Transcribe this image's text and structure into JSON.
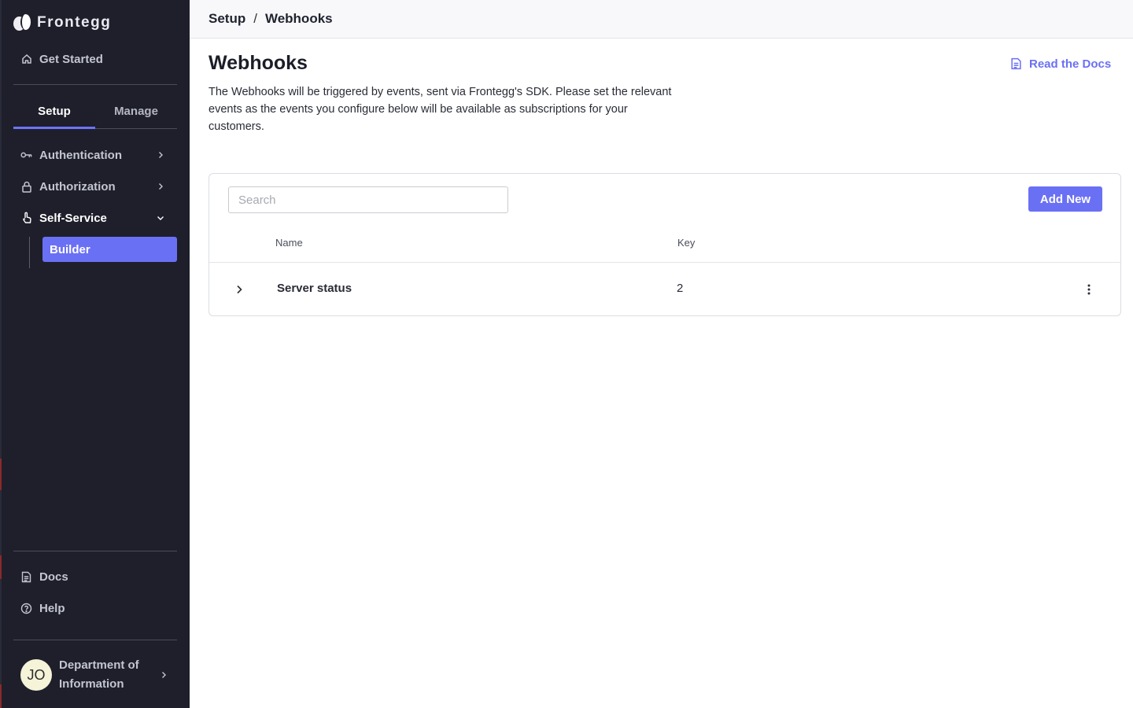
{
  "app": {
    "brand": "Frontegg"
  },
  "sidebar": {
    "get_started": "Get Started",
    "tabs": [
      {
        "label": "Setup",
        "active": true
      },
      {
        "label": "Manage",
        "active": false
      }
    ],
    "items": [
      {
        "label": "Authentication",
        "icon": "key-icon",
        "chevron": "right"
      },
      {
        "label": "Authorization",
        "icon": "lock-icon",
        "chevron": "right"
      },
      {
        "label": "Self-Service",
        "icon": "hand-pointer-icon",
        "chevron": "down",
        "expanded": true
      }
    ],
    "sub_items": [
      {
        "label": "Builder",
        "active": true
      }
    ],
    "bottom": [
      {
        "label": "Docs",
        "icon": "document-icon"
      },
      {
        "label": "Help",
        "icon": "help-circle-icon"
      }
    ],
    "user": {
      "initials": "JO",
      "name": "Department of Information"
    }
  },
  "breadcrumb": {
    "parent": "Setup",
    "separator": "/",
    "current": "Webhooks"
  },
  "page": {
    "title": "Webhooks",
    "description": "The Webhooks will be triggered by events, sent via Frontegg's SDK. Please set the relevant events as the events you configure below will be available as subscriptions for your customers.",
    "docs_link": "Read the Docs"
  },
  "table": {
    "search_placeholder": "Search",
    "add_button": "Add New",
    "columns": [
      "Name",
      "Key"
    ],
    "rows": [
      {
        "name": "Server status",
        "key": "2"
      }
    ]
  },
  "colors": {
    "accent": "#6a70f4",
    "sidebar_bg": "#1e1f2b"
  }
}
